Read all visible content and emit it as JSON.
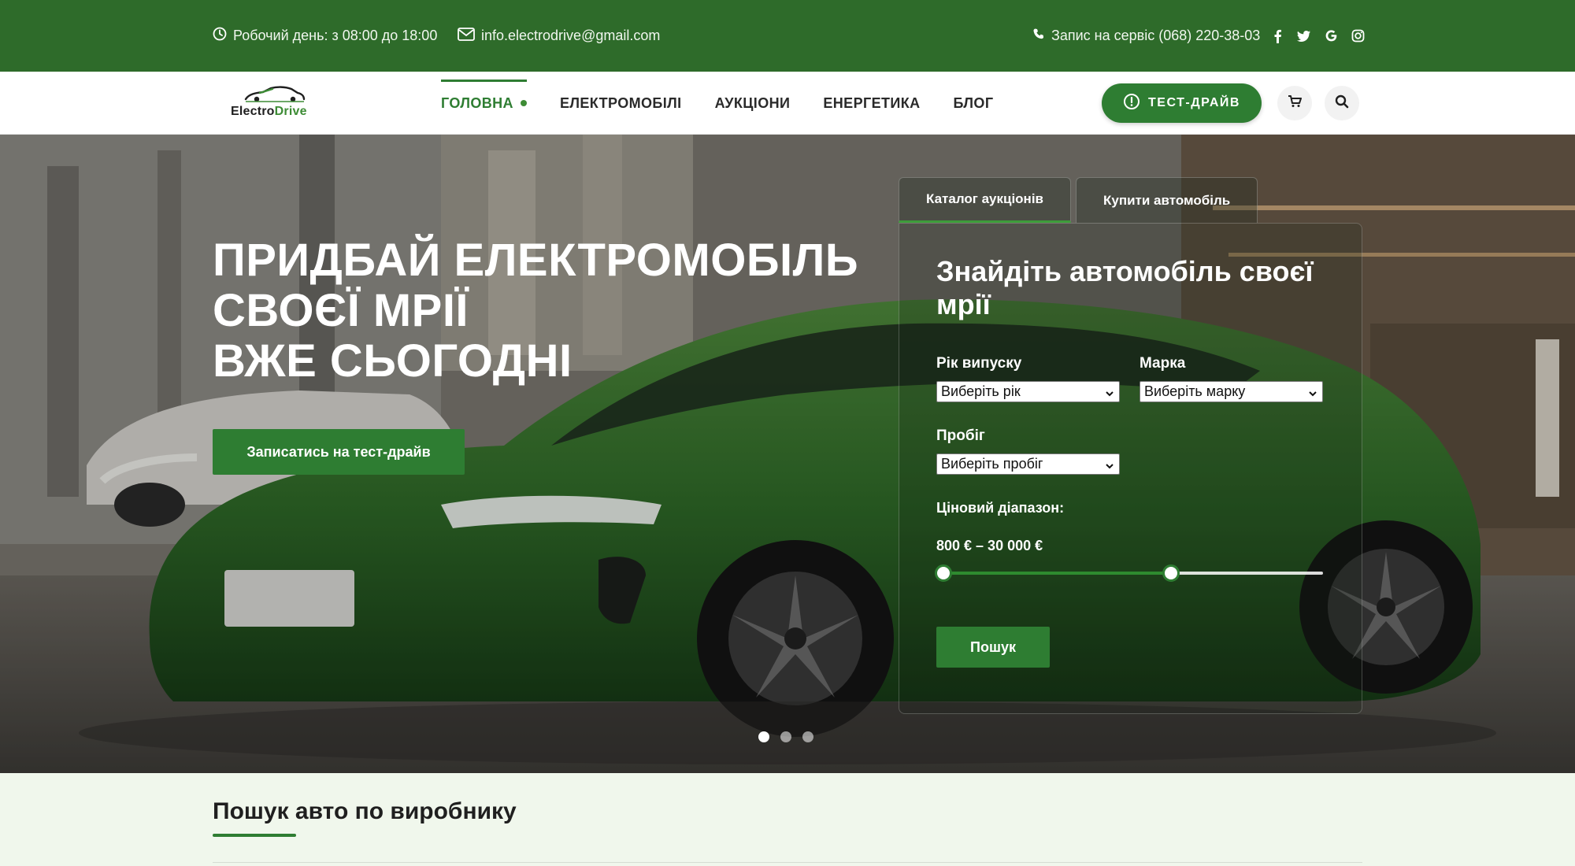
{
  "topbar": {
    "hours": "Робочий день: з 08:00 до 18:00",
    "email": "info.electrodrive@gmail.com",
    "phone": "Запис на сервіс (068) 220-38-03",
    "social_icons": [
      "facebook-icon",
      "twitter-icon",
      "google-icon",
      "instagram-icon"
    ]
  },
  "logo": {
    "part1": "Electro",
    "part2": "Drive"
  },
  "nav": {
    "items": [
      {
        "label": "ГОЛОВНА"
      },
      {
        "label": "ЕЛЕКТРОМОБІЛІ"
      },
      {
        "label": "АУКЦІОНИ"
      },
      {
        "label": "ЕНЕРГЕТИКА"
      },
      {
        "label": "БЛОГ"
      }
    ],
    "active_index": 0,
    "test_drive_label": "ТЕСТ-ДРАЙВ"
  },
  "hero": {
    "title_lines": [
      "ПРИДБАЙ ЕЛЕКТРОМОБІЛЬ",
      "СВОЄЇ МРІЇ",
      "ВЖЕ СЬОГОДНІ"
    ],
    "cta_label": "Записатись на тест-драйв",
    "slides_count": 3,
    "active_slide": 0
  },
  "search_panel": {
    "tabs": [
      {
        "label": "Каталог аукціонів"
      },
      {
        "label": "Купити автомобіль"
      }
    ],
    "active_tab": 0,
    "title": "Знайдіть автомобіль своєї мрії",
    "year": {
      "label": "Рік випуску",
      "value": "Виберіть рік"
    },
    "brand": {
      "label": "Марка",
      "value": "Виберіть марку"
    },
    "mileage": {
      "label": "Пробіг",
      "value": "Виберіть пробіг"
    },
    "price": {
      "label": "Ціновий діапазон:",
      "text": "800 € – 30 000 €",
      "min_fraction": 0.0,
      "max_fraction": 0.6
    },
    "search_label": "Пошук"
  },
  "brands_section": {
    "title": "Пошук авто по виробнику"
  },
  "colors": {
    "brand_green": "#2e7d32",
    "topbar_green": "#2e6b2a",
    "section_bg": "#f0f7ec"
  }
}
